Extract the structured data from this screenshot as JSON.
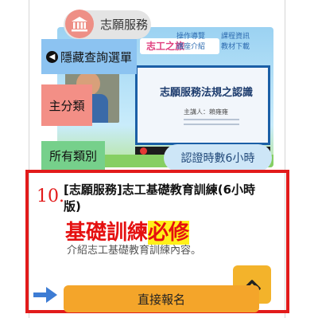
{
  "category": {
    "label": "志願服務",
    "icon": "temple-icon"
  },
  "thumbnail": {
    "banner_title": "志工之旅",
    "menu": [
      "操作導覽",
      "課程資訊",
      "講座介紹",
      "教材下載"
    ],
    "slide_title": "志願服務法規之認識",
    "presenter": "主講人：賴雍雍"
  },
  "filters": {
    "hide_menu_label": "隱藏查詢選單",
    "hide_menu_icon": "arrow-left-icon",
    "main_category_label": "主分類",
    "all_categories_label": "所有類別"
  },
  "hours_badge": "認證時數6小時",
  "course": {
    "number": "10.",
    "title": "[志願服務]志工基礎教育訓練(6小時版)",
    "annotation_part1": "基礎訓練",
    "annotation_part2": "必修",
    "description": "介紹志工基礎教育訓練內容。"
  },
  "register_label": "直接報名",
  "colors": {
    "accent_red": "#e21b1b",
    "button_orange": "#f4a52a",
    "highlight_yellow": "#fff01a",
    "hide_menu_blue": "#8cc3f1",
    "main_category_pink": "#f38f86",
    "all_categories_green": "#76d08b",
    "arrow_blue": "#3d7cd4"
  }
}
